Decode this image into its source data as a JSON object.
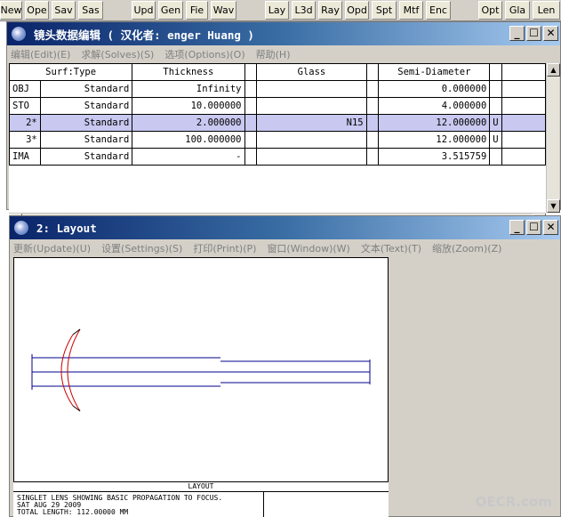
{
  "toolbar": {
    "buttons": [
      "New",
      "Ope",
      "Sav",
      "Sas",
      "Upd",
      "Gen",
      "Fie",
      "Wav",
      "Lay",
      "L3d",
      "Ray",
      "Opd",
      "Spt",
      "Mtf",
      "Enc",
      "Opt",
      "Gla",
      "Len"
    ]
  },
  "lde_window": {
    "title": "镜头数据编辑  ( 汉化者: enger Huang )",
    "menu": [
      "编辑(Edit)(E)",
      "求解(Solves)(S)",
      "选项(Options)(O)",
      "帮助(H)"
    ],
    "columns": [
      "Surf:Type",
      "Thickness",
      "Glass",
      "Semi-Diameter"
    ],
    "rows": [
      {
        "surf": "OBJ",
        "type": "Standard",
        "thickness": "Infinity",
        "glass": "",
        "semi_diameter": "0.000000",
        "flag": ""
      },
      {
        "surf": "STO",
        "type": "Standard",
        "thickness": "10.000000",
        "glass": "",
        "semi_diameter": "4.000000",
        "flag": ""
      },
      {
        "surf": "2*",
        "type": "Standard",
        "thickness": "2.000000",
        "glass": "N15",
        "semi_diameter": "12.000000",
        "flag": "U"
      },
      {
        "surf": "3*",
        "type": "Standard",
        "thickness": "100.000000",
        "glass": "",
        "semi_diameter": "12.000000",
        "flag": "U"
      },
      {
        "surf": "IMA",
        "type": "Standard",
        "thickness": "-",
        "glass": "",
        "semi_diameter": "3.515759",
        "flag": ""
      }
    ],
    "selected_row": 2
  },
  "layout_window": {
    "title": "2: Layout",
    "menu": [
      "更新(Update)(U)",
      "设置(Settings)(S)",
      "打印(Print)(P)",
      "窗口(Window)(W)",
      "文本(Text)(T)",
      "缩放(Zoom)(Z)"
    ],
    "caption_header": "LAYOUT",
    "caption_lines": [
      "SINGLET LENS SHOWING BASIC PROPAGATION TO FOCUS.",
      "SAT AUG 29 2009",
      "TOTAL LENGTH:   112.00000 MM"
    ]
  },
  "watermark": "OECR.com",
  "colors": {
    "selected_row": "#c8c8f0",
    "ray": "#00008b",
    "lens": "#cc0000"
  }
}
